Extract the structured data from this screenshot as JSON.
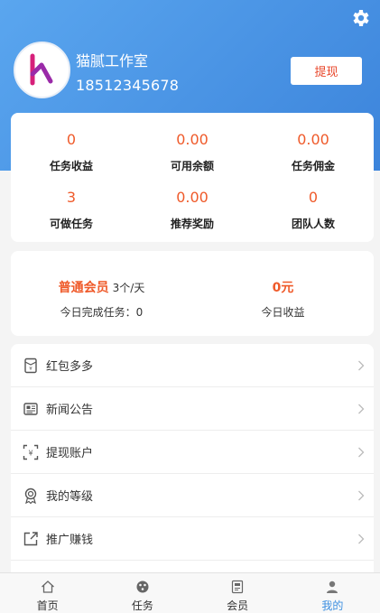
{
  "profile": {
    "name": "猫腻工作室",
    "phone": "18512345678",
    "withdraw_label": "提现"
  },
  "stats": [
    {
      "value": "0",
      "label": "任务收益"
    },
    {
      "value": "0.00",
      "label": "可用余额"
    },
    {
      "value": "0.00",
      "label": "任务佣金"
    },
    {
      "value": "3",
      "label": "可做任务"
    },
    {
      "value": "0.00",
      "label": "推荐奖励"
    },
    {
      "value": "0",
      "label": "团队人数"
    }
  ],
  "membership": {
    "level": "普通会员",
    "rate": "3个/天",
    "today_done": "今日完成任务：0",
    "today_income_value": "0元",
    "today_income_label": "今日收益"
  },
  "menu": [
    {
      "label": "红包多多",
      "icon": "red-envelope-icon"
    },
    {
      "label": "新闻公告",
      "icon": "news-icon"
    },
    {
      "label": "提现账户",
      "icon": "wallet-scan-icon"
    },
    {
      "label": "我的等级",
      "icon": "medal-icon"
    },
    {
      "label": "推广赚钱",
      "icon": "share-icon"
    }
  ],
  "tabs": [
    {
      "label": "首页",
      "icon": "home-icon"
    },
    {
      "label": "任务",
      "icon": "task-icon"
    },
    {
      "label": "会员",
      "icon": "member-icon"
    },
    {
      "label": "我的",
      "icon": "user-icon"
    }
  ],
  "colors": {
    "header_start": "#5aa6ef",
    "header_end": "#3c84db",
    "accent": "#ef5a2a",
    "tab_active": "#3d8fe0"
  }
}
